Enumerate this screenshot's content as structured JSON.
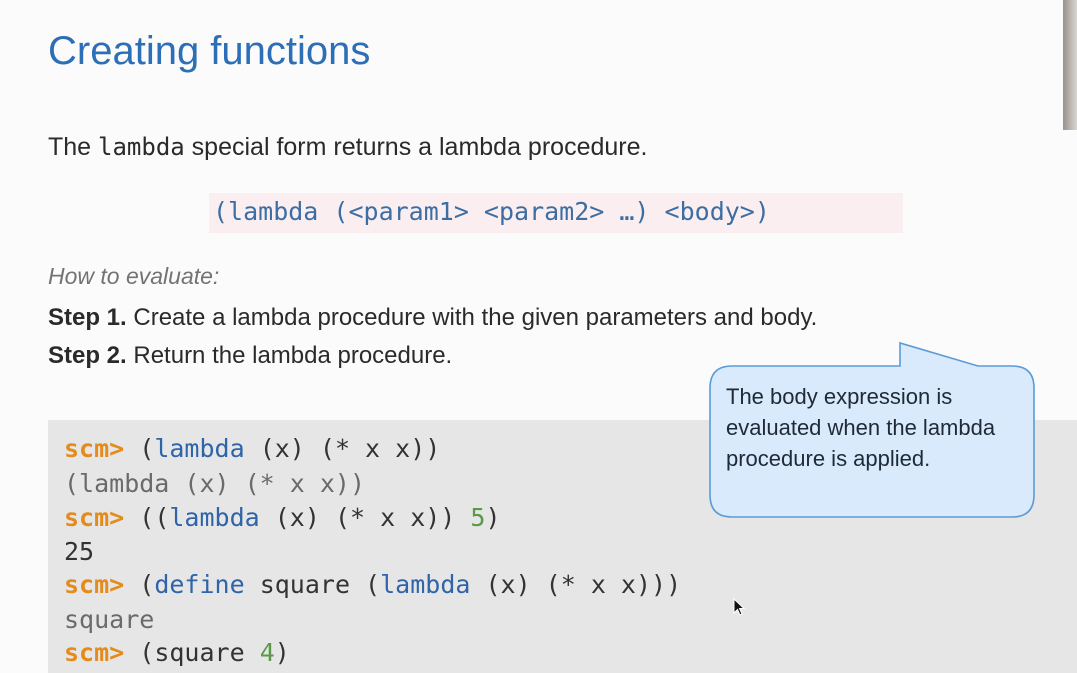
{
  "slide": {
    "title": "Creating functions",
    "intro": {
      "before": "The ",
      "keyword": "lambda",
      "after": " special form returns a lambda procedure."
    },
    "syntax": "(lambda (<param1> <param2> …) <body>)",
    "how_to_label": "How to evaluate:",
    "steps": [
      {
        "label": "Step 1.",
        "text": " Create a lambda procedure with the given parameters and body."
      },
      {
        "label": "Step 2.",
        "text": " Return the lambda procedure."
      }
    ],
    "callout": "The body expression is evaluated when the lambda procedure is applied."
  },
  "code": {
    "prompt": "scm>",
    "line1": {
      "p1": " (",
      "kw": "lambda",
      "p2": " (x) (* x x))"
    },
    "out1": "(lambda (x) (* x x))",
    "line2": {
      "p1": " ((",
      "kw": "lambda",
      "p2": " (x) (* x x)) ",
      "num": "5",
      "p3": ")"
    },
    "out2": "25",
    "line3": {
      "p1": " (",
      "kw1": "define",
      "p2": " square (",
      "kw2": "lambda",
      "p3": " (x) (* x x)))"
    },
    "out3": "square",
    "line4": {
      "p1": " (square ",
      "num": "4",
      "p2": ")"
    }
  },
  "colors": {
    "title": "#2c6fb6",
    "prompt": "#e48b1c",
    "keyword": "#2f64a8",
    "number": "#5a9a47",
    "callout_fill": "#d8eafc",
    "callout_border": "#5b9bd5",
    "syntax_bg": "#fbeef0"
  }
}
